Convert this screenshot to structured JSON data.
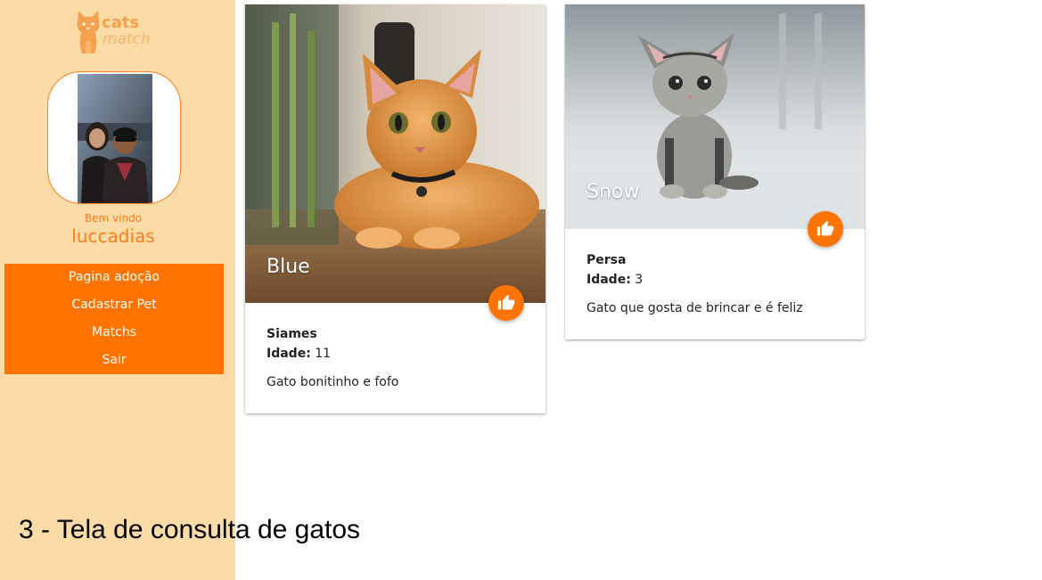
{
  "brand": {
    "line1": "cats",
    "line2": "match"
  },
  "user": {
    "welcome": "Bem vindo",
    "name": "luccadias"
  },
  "menu": [
    {
      "label": "Pagina adoção"
    },
    {
      "label": "Cadastrar Pet"
    },
    {
      "label": "Matchs"
    },
    {
      "label": "Sair"
    }
  ],
  "cats": [
    {
      "name": "Blue",
      "breed": "Siames",
      "age_label": "Idade:",
      "age": "11",
      "description": "Gato bonitinho e fofo"
    },
    {
      "name": "Snow",
      "breed": "Persa",
      "age_label": "Idade:",
      "age": "3",
      "description": "Gato que gosta de brincar e é feliz"
    }
  ],
  "caption": "3 - Tela de consulta de gatos",
  "colors": {
    "accent": "#ff7300",
    "sidebar": "#fbdca6"
  },
  "icons": {
    "like": "thumbs-up-icon",
    "logo": "cat-logo-icon"
  }
}
